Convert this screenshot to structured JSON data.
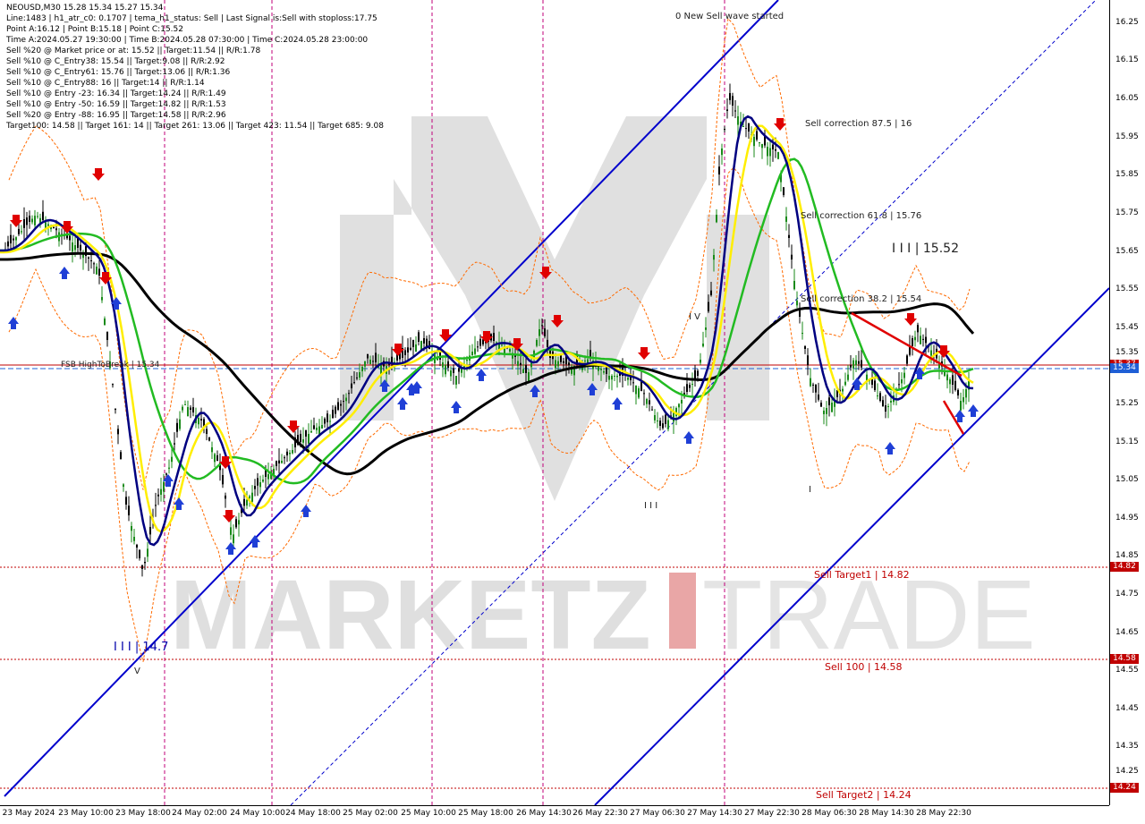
{
  "header": {
    "lines": [
      "NEOUSD,M30  15.28 15.34 15.27 15.34",
      "Line:1483  |  h1_atr_c0: 0.1707  |  tema_h1_status: Sell  |  Last Signal is:Sell with stoploss:17.75",
      "Point A:16.12  |  Point B:15.18  |  Point C:15.52",
      "Time A:2024.05.27 19:30:00  |  Time B:2024.05.28 07:30:00  |  Time C:2024.05.28 23:00:00",
      "Sell %20 @ Market price or at: 15.52  ||  Target:11.54  ||  R/R:1.78",
      "Sell %10 @ C_Entry38: 15.54  ||  Target:9.08  ||  R/R:2.92",
      "Sell %10 @ C_Entry61: 15.76  ||  Target:13.06  ||  R/R:1.36",
      "Sell %10 @ C_Entry88: 16  ||  Target:14  ||  R/R:1.14",
      "Sell %10 @ Entry -23: 16.34  ||  Target:14.24  ||  R/R:1.49",
      "Sell %10 @ Entry -50: 16.59  ||  Target:14.82  ||  R/R:1.53",
      "Sell %20 @ Entry -88: 16.95  ||  Target:14.58  ||  R/R:2.96",
      "Target100: 14.58  ||  Target 161: 14  ||  Target 261: 13.06  ||  Target 423: 11.54  ||  Target 685: 9.08"
    ]
  },
  "price_axis": {
    "labels": [
      "16.25",
      "16.15",
      "16.05",
      "15.95",
      "15.85",
      "15.75",
      "15.65",
      "15.55",
      "15.45",
      "15.35",
      "15.25",
      "15.15",
      "15.05",
      "14.95",
      "14.85",
      "14.75",
      "14.65",
      "14.55",
      "14.45",
      "14.35",
      "14.25"
    ],
    "tags": [
      {
        "text": "15.34",
        "color": "#1f5fd6"
      },
      {
        "text": "14.82",
        "color": "#c00000"
      },
      {
        "text": "14.58",
        "color": "#c00000"
      },
      {
        "text": "14.24",
        "color": "#c00000"
      },
      {
        "text": "15.37",
        "color": "#c00000"
      }
    ]
  },
  "time_axis": [
    "23 May 2024",
    "23 May 10:00",
    "23 May 18:00",
    "24 May 02:00",
    "24 May 10:00",
    "24 May 18:00",
    "25 May 02:00",
    "25 May 10:00",
    "25 May 18:00",
    "26 May 14:30",
    "26 May 22:30",
    "27 May 06:30",
    "27 May 14:30",
    "27 May 22:30",
    "28 May 06:30",
    "28 May 14:30",
    "28 May 22:30"
  ],
  "annotations": {
    "wave": "0 New Sell wave started",
    "corr875": "Sell correction 87.5 | 16",
    "corr618": "Sell correction 61.8 | 15.76",
    "corr382": "Sell correction 38.2 | 15.54",
    "pointC": "I I I | 15.52",
    "pointLow": "I I I | 14.7",
    "fsb": "FSB HighToBreak | 15.34",
    "iv": "I V",
    "iii": "I I I",
    "v": "V",
    "i": "I"
  },
  "levels": {
    "target1": "Sell Target1 | 14.82",
    "target100": "Sell 100 | 14.58",
    "target2": "Sell Target2 | 14.24"
  },
  "watermark": {
    "part1": "MARKETZ",
    "part2": "TRADE"
  },
  "colors": {
    "channel": "#0000cc",
    "ma_black": "#000000",
    "ma_green": "#22bb22",
    "ma_yellow": "#ffee00",
    "ma_navy": "#000080",
    "level_red": "#c00000",
    "current_blue": "#1f5fd6"
  }
}
